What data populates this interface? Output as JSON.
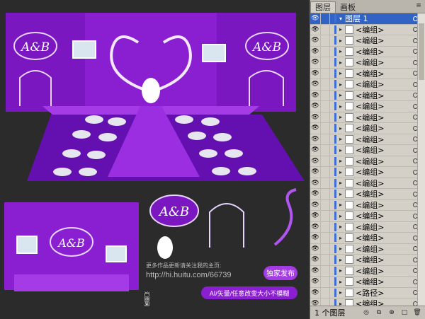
{
  "artwork": {
    "monogram": "A&B",
    "promo_line1": "更多作品更新请关注我的主页:",
    "url": "http://hi.huitu.com/66739",
    "exclusive_badge": "独家发布",
    "bottom_banner": "AI/矢量/任意改变大小不模糊",
    "watermark": "汇图网",
    "colors": {
      "purple": "#8a1fd1",
      "deep_purple": "#5a0f9c",
      "light": "#e9d4ff",
      "accent": "#a43be6",
      "bg": "#2b2b2b"
    }
  },
  "layers_panel": {
    "tabs": [
      "图层",
      "画板"
    ],
    "active_tab": "图层",
    "rows": [
      {
        "name": "图层 1",
        "expanded": true,
        "selected": true
      },
      {
        "name": "<编组>"
      },
      {
        "name": "<编组>"
      },
      {
        "name": "<编组>"
      },
      {
        "name": "<编组>"
      },
      {
        "name": "<编组>"
      },
      {
        "name": "<编组>"
      },
      {
        "name": "<编组>"
      },
      {
        "name": "<编组>"
      },
      {
        "name": "<编组>"
      },
      {
        "name": "<编组>"
      },
      {
        "name": "<编组>"
      },
      {
        "name": "<编组>"
      },
      {
        "name": "<编组>"
      },
      {
        "name": "<编组>"
      },
      {
        "name": "<编组>"
      },
      {
        "name": "<编组>"
      },
      {
        "name": "<编组>"
      },
      {
        "name": "<编组>"
      },
      {
        "name": "<编组>"
      },
      {
        "name": "<编组>"
      },
      {
        "name": "<编组>"
      },
      {
        "name": "<编组>"
      },
      {
        "name": "<编组>"
      },
      {
        "name": "<编组>"
      },
      {
        "name": "<路径>"
      },
      {
        "name": "<编组>"
      }
    ],
    "footer_count": "1 个图层"
  }
}
